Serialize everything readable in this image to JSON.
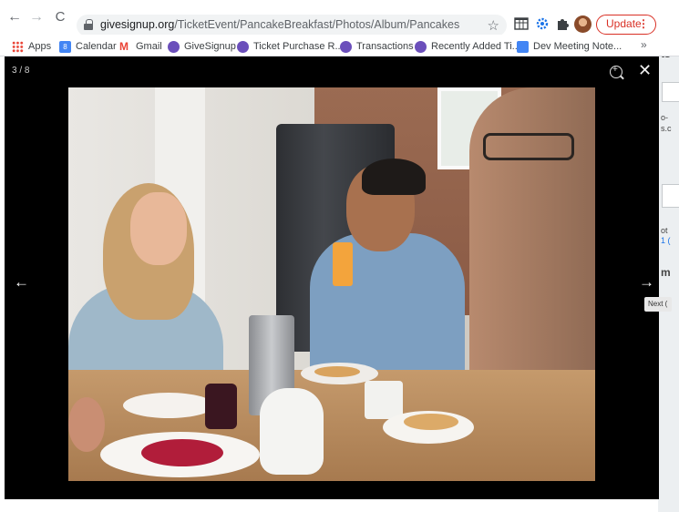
{
  "browser": {
    "url_host": "givesignup.org",
    "url_path": "/TicketEvent/PancakeBreakfast/Photos/Album/Pancakes",
    "update_label": "Update",
    "update_menu": "⋮",
    "nav": {
      "back": "←",
      "forward": "→",
      "reload": "C"
    },
    "star": "☆",
    "icons": [
      "grid-extension-icon",
      "gear-extension-icon",
      "puzzle-extensions-icon",
      "profile-avatar"
    ],
    "accent_color": "#d93025"
  },
  "bookmarks": [
    {
      "label": "Apps",
      "icon": "apps-grid-icon"
    },
    {
      "label": "Calendar",
      "icon": "calendar-icon",
      "glyph": "8"
    },
    {
      "label": "Gmail",
      "icon": "gmail-icon",
      "glyph": "M"
    },
    {
      "label": "GiveSignup",
      "icon": "givesignup-icon"
    },
    {
      "label": "Ticket Purchase R...",
      "icon": "givesignup-icon"
    },
    {
      "label": "Transactions",
      "icon": "givesignup-icon"
    },
    {
      "label": "Recently Added Ti...",
      "icon": "givesignup-icon"
    },
    {
      "label": "Dev Meeting Note...",
      "icon": "docs-icon"
    }
  ],
  "bookmarks_overflow": "»",
  "lightbox": {
    "counter": "3 / 8",
    "close": "✕",
    "prev": "←",
    "next": "→",
    "next_tooltip": "Next (",
    "background": "#000000"
  },
  "background_page": {
    "fragments": [
      "ts",
      "o-",
      "s.c",
      "ot",
      "1 (",
      "m"
    ]
  }
}
